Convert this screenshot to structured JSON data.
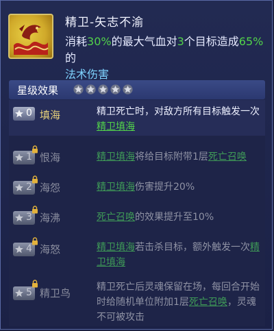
{
  "skill": {
    "title": "精卫-矢志不渝",
    "desc_p1": "消耗",
    "desc_pct1": "30%",
    "desc_p2": "的最大气血对",
    "desc_num": "3",
    "desc_p3": "个目标造成",
    "desc_pct2": "65%",
    "desc_p4": "的",
    "desc_dmg": "法术伤害"
  },
  "star_section": {
    "title": "星级效果",
    "stars_filled": 5,
    "stars_total": 5
  },
  "tiers": [
    {
      "level": "0",
      "name": "填海",
      "locked": false,
      "desc": {
        "a": "精卫死亡时，对敌方所有目标触发一次",
        "link1": "精卫填海"
      }
    },
    {
      "level": "1",
      "name": "恨海",
      "locked": true,
      "desc": {
        "link1": "精卫填海",
        "a": "将给目标附带1层",
        "link2": "死亡召唤"
      }
    },
    {
      "level": "2",
      "name": "海怨",
      "locked": true,
      "desc": {
        "link1": "精卫填海",
        "a": "伤害提升20%"
      }
    },
    {
      "level": "3",
      "name": "海沸",
      "locked": true,
      "desc": {
        "link1": "死亡召唤",
        "a": "的效果提升至10%"
      }
    },
    {
      "level": "4",
      "name": "海怒",
      "locked": true,
      "desc": {
        "link1": "精卫填海",
        "a": "若击杀目标，额外触发一次",
        "link2": "精卫填海"
      }
    },
    {
      "level": "5",
      "name": "精卫鸟",
      "locked": true,
      "desc": {
        "a": "精卫死亡后灵魂保留在场，每回合开始时给随机单位附加1层",
        "link1": "死亡召唤",
        "b": "，灵魂不可被攻击"
      }
    }
  ],
  "colors": {
    "accent_green": "#52d24a",
    "accent_cyan": "#7fd3ff",
    "active_name": "#e6d07a",
    "star_silver": "#d9dce6"
  },
  "icons": {
    "skill": "bird-wave-emblem-icon",
    "star": "star-icon",
    "lock": "padlock-icon"
  }
}
